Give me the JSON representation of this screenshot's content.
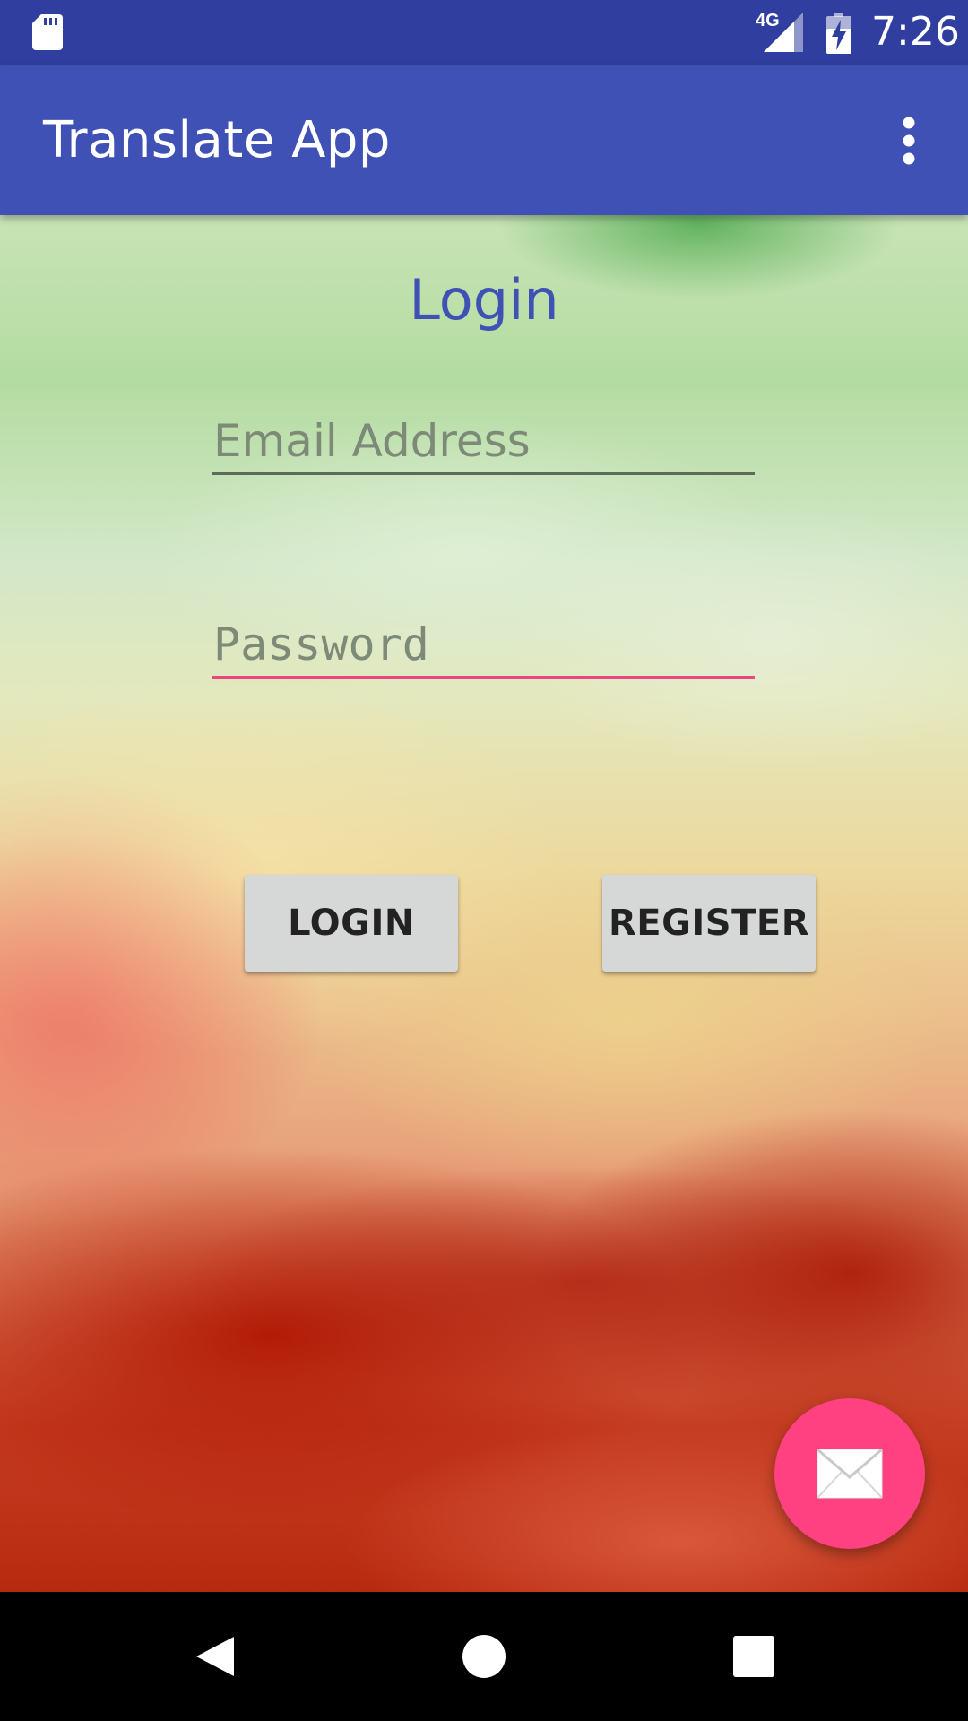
{
  "status_bar": {
    "network_label": "4G",
    "time": "7:26",
    "icons": [
      "sd-card-icon",
      "signal-icon",
      "battery-charging-icon"
    ],
    "background_color": "#303F9F"
  },
  "app_bar": {
    "title": "Translate App",
    "overflow_icon": "more-vert-icon",
    "background_color": "#3F51B5"
  },
  "login_form": {
    "title": "Login",
    "title_color": "#3F51B5",
    "email_placeholder": "Email Address",
    "email_value": "",
    "password_placeholder": "Password",
    "password_value": "",
    "login_button_label": "LOGIN",
    "register_button_label": "REGISTER",
    "focused_underline_color": "#E94784"
  },
  "fab": {
    "icon": "email-icon",
    "color": "#FF4081"
  },
  "nav_bar": {
    "icons": [
      "back-icon",
      "home-icon",
      "recents-icon"
    ]
  }
}
